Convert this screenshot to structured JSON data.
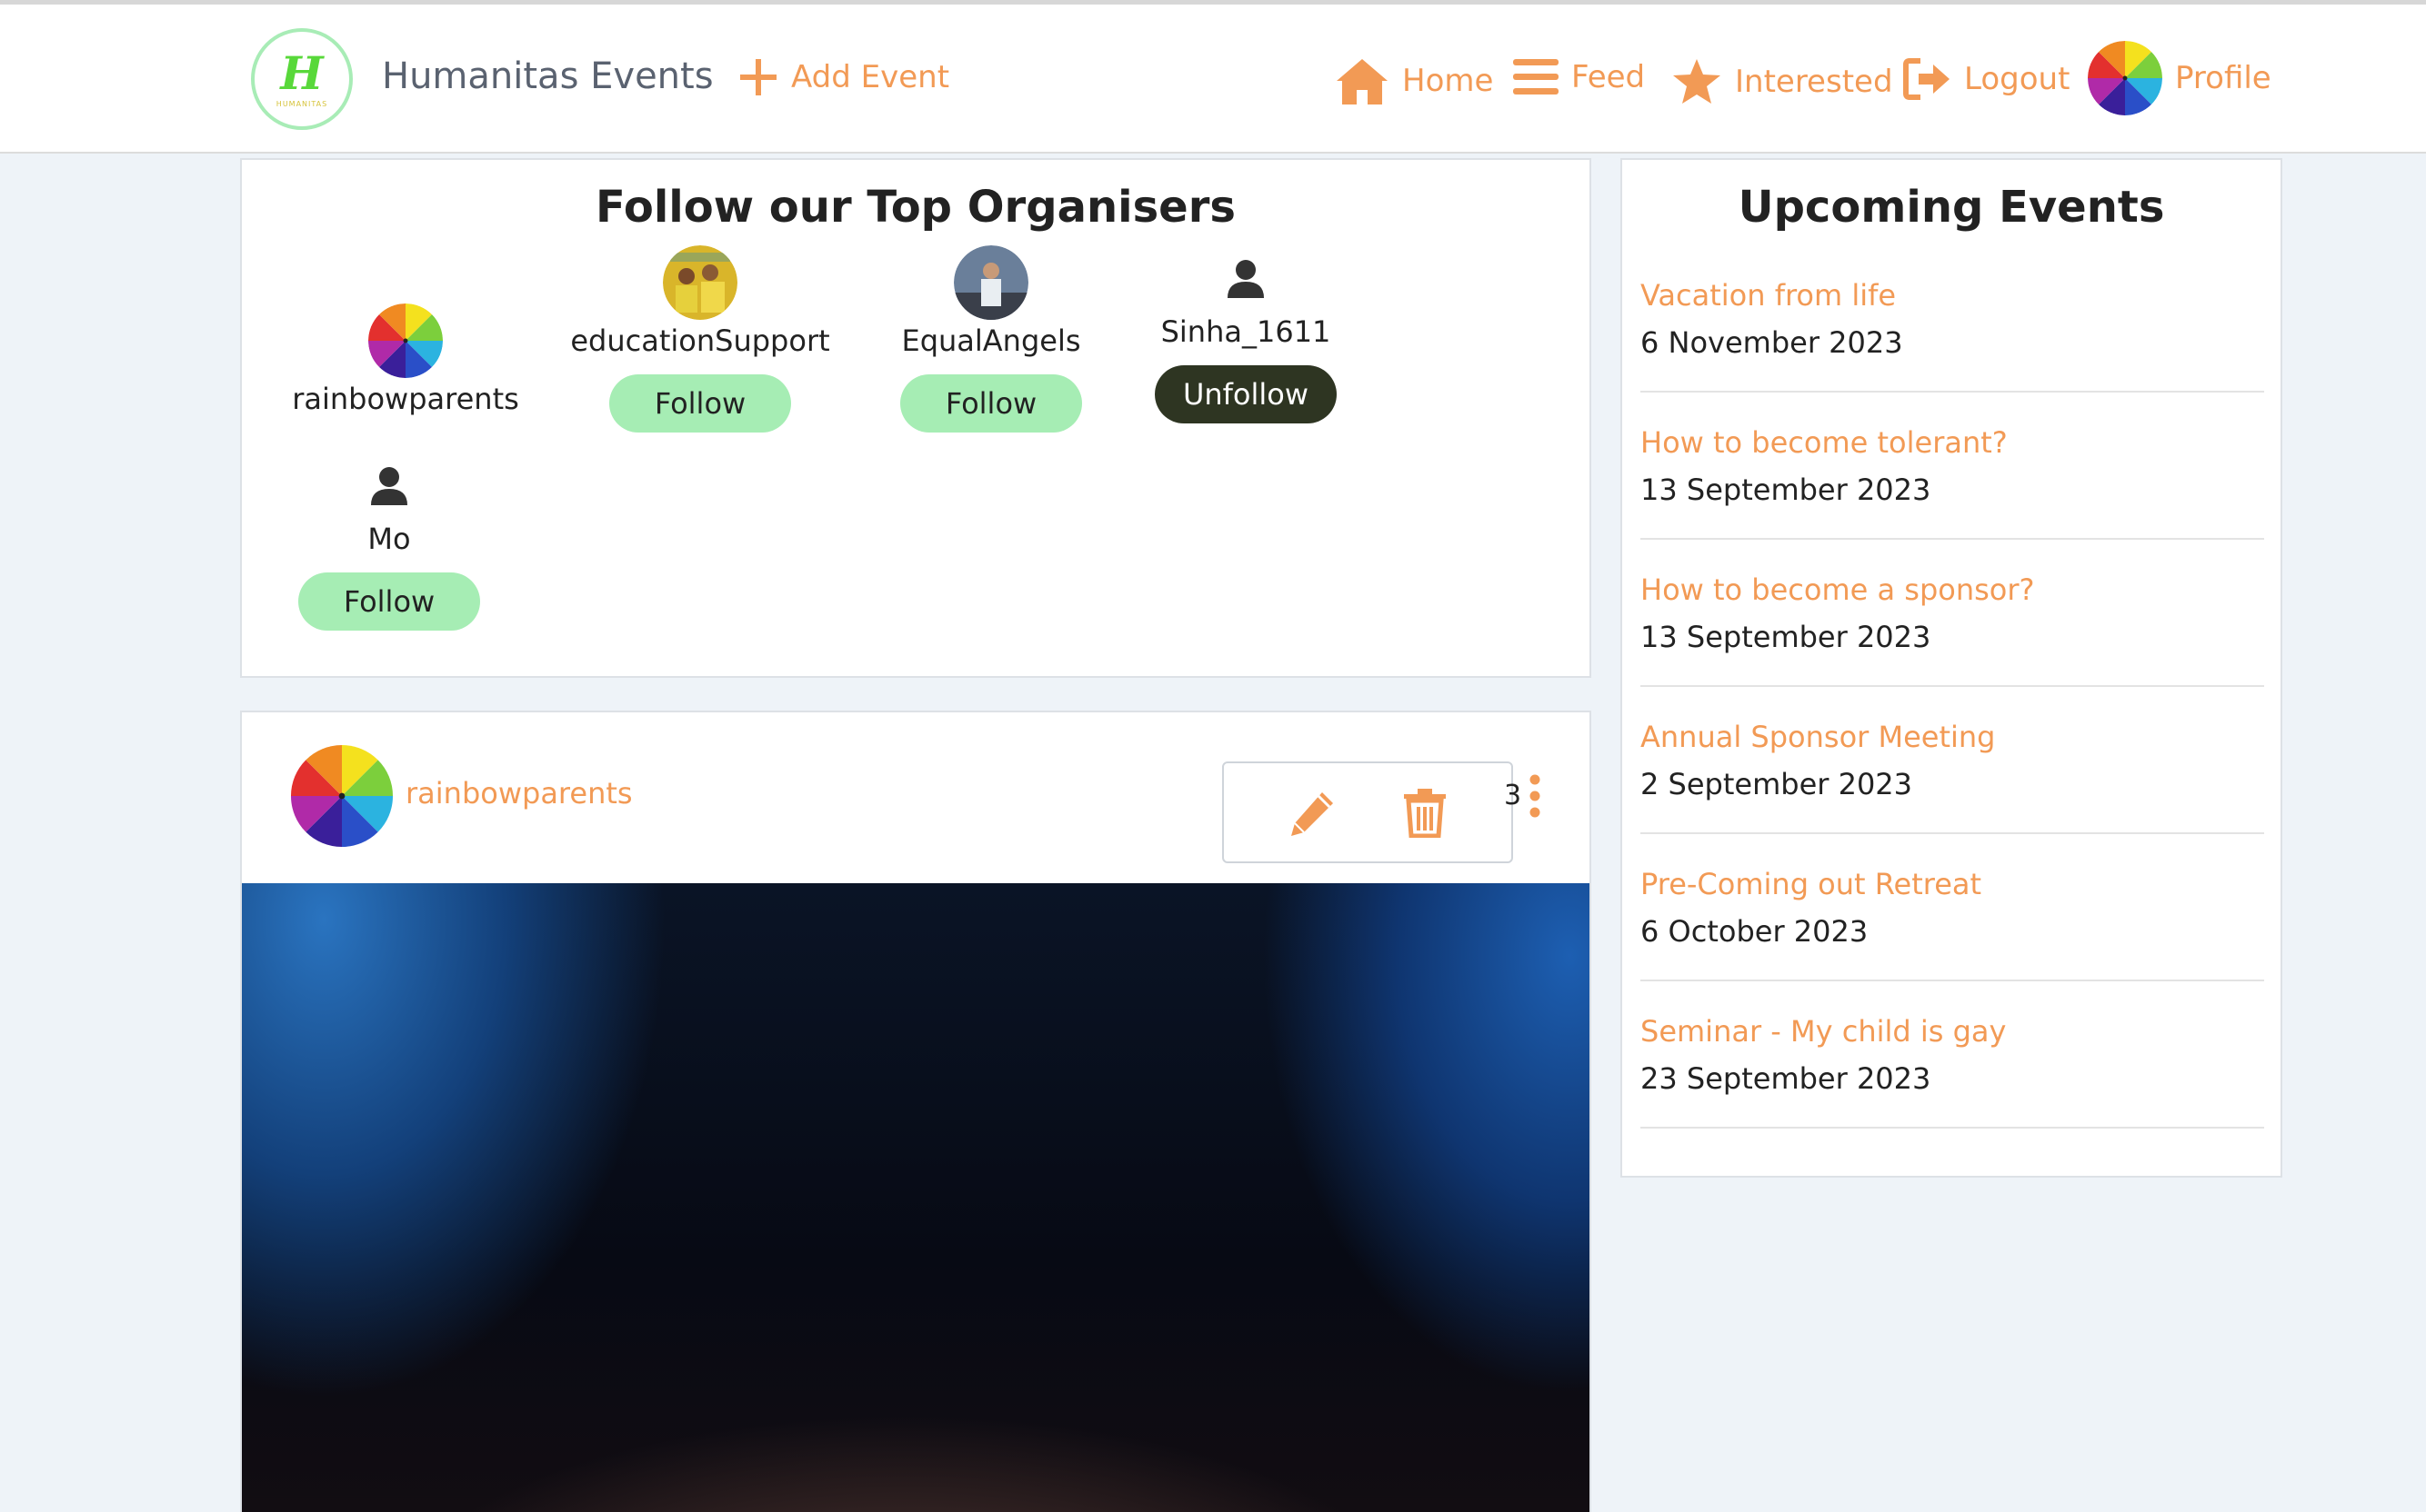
{
  "nav": {
    "brand": "Humanitas Events",
    "logo_letter": "H",
    "logo_small_text": "HUMANITAS",
    "add_event": "Add Event",
    "home": "Home",
    "feed": "Feed",
    "interested": "Interested",
    "logout": "Logout",
    "profile": "Profile"
  },
  "organisers": {
    "title": "Follow our Top Organisers",
    "items": [
      {
        "name": "rainbowparents",
        "button": ""
      },
      {
        "name": "educationSupport",
        "button": "Follow"
      },
      {
        "name": "EqualAngels",
        "button": "Follow"
      },
      {
        "name": "Sinha_1611",
        "button": "Unfollow"
      },
      {
        "name": "Mo",
        "button": "Follow"
      }
    ]
  },
  "upcoming": {
    "title": "Upcoming Events",
    "events": [
      {
        "title": "Vacation from life",
        "date": "6 November 2023"
      },
      {
        "title": "How to become tolerant?",
        "date": "13 September 2023"
      },
      {
        "title": "How to become a sponsor?",
        "date": "13 September 2023"
      },
      {
        "title": "Annual Sponsor Meeting",
        "date": "2 September 2023"
      },
      {
        "title": "Pre-Coming out Retreat",
        "date": "6 October 2023"
      },
      {
        "title": "Seminar - My child is gay",
        "date": "23 September 2023"
      }
    ]
  },
  "post": {
    "author": "rainbowparents",
    "partial_text": "3"
  },
  "colors": {
    "accent": "#f29a55",
    "follow_button": "#a6edb4",
    "unfollow_button": "#2e3522",
    "background": "#eef3f8"
  },
  "icons": [
    "plus-icon",
    "home-icon",
    "menu-icon",
    "star-icon",
    "logout-icon",
    "user-icon",
    "pencil-icon",
    "trash-icon",
    "more-vertical-icon"
  ]
}
